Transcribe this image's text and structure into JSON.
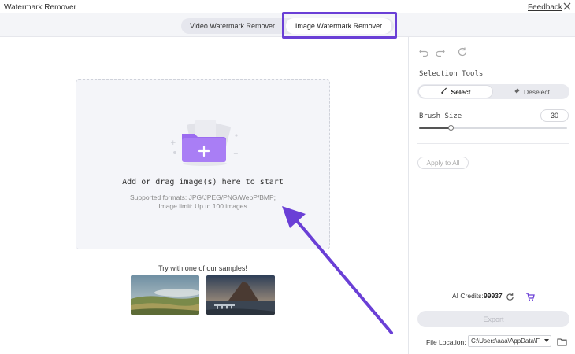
{
  "app": {
    "title": "Watermark Remover",
    "feedback_label": "Feedback",
    "close_icon": "close-icon"
  },
  "tabs": [
    {
      "label": "Video Watermark Remover",
      "active": false
    },
    {
      "label": "Image Watermark Remover",
      "active": true
    }
  ],
  "dropzone": {
    "title": "Add or drag image(s) here to start",
    "formats": "Supported formats: JPG/JPEG/PNG/WebP/BMP;",
    "limit": "Image limit: Up to 100 images",
    "icon": "add-folder-icon"
  },
  "samples": {
    "label": "Try with one of our samples!"
  },
  "sidebar": {
    "history_icons": [
      "undo-icon",
      "redo-icon",
      "reset-icon"
    ],
    "selection_tools_label": "Selection Tools",
    "select_label": "Select",
    "deselect_label": "Deselect",
    "brush_size_label": "Brush Size",
    "brush_size_value": "30",
    "brush_slider_fraction": 0.22,
    "apply_all_label": "Apply to All",
    "credits_label": "AI Credits:",
    "credits_value": "99937",
    "export_label": "Export",
    "file_location_label": "File Location:",
    "file_location_value": "C:\\Users\\aaa\\AppData\\F"
  },
  "colors": {
    "accent": "#6a3fd6",
    "folder": "#9b6cf0"
  }
}
